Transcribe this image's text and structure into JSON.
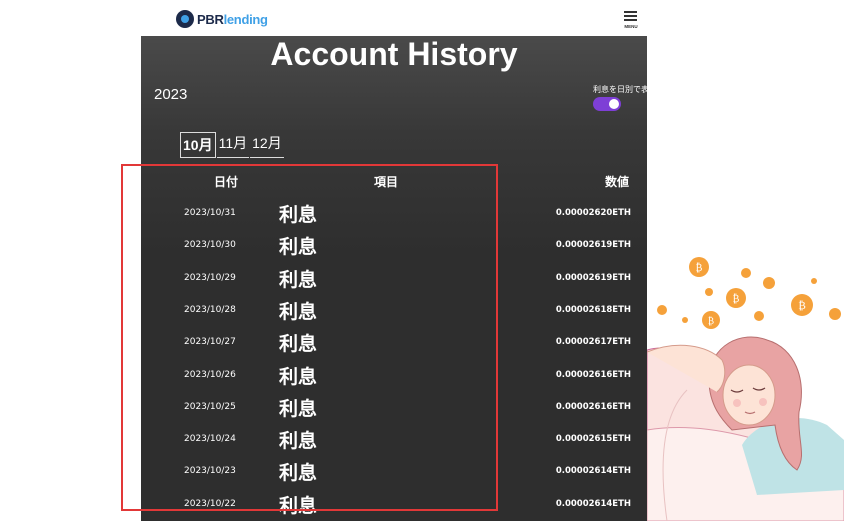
{
  "brand": {
    "logo_pbr": "PBR",
    "logo_lending": "lending"
  },
  "menu": {
    "label": "MENU"
  },
  "page_title": "Account History",
  "year": "2023",
  "toggle": {
    "label": "利息を日別で表示",
    "on": true,
    "color": "#7e3fd6"
  },
  "months": [
    {
      "label": "10月",
      "active": true
    },
    {
      "label": "11月",
      "active": false
    },
    {
      "label": "12月",
      "active": false
    }
  ],
  "table": {
    "headers": {
      "date": "日付",
      "item": "項目",
      "value": "数値"
    },
    "rows": [
      {
        "date": "2023/10/31",
        "item": "利息",
        "amount": "0.00002620ETH"
      },
      {
        "date": "2023/10/30",
        "item": "利息",
        "amount": "0.00002619ETH"
      },
      {
        "date": "2023/10/29",
        "item": "利息",
        "amount": "0.00002619ETH"
      },
      {
        "date": "2023/10/28",
        "item": "利息",
        "amount": "0.00002618ETH"
      },
      {
        "date": "2023/10/27",
        "item": "利息",
        "amount": "0.00002617ETH"
      },
      {
        "date": "2023/10/26",
        "item": "利息",
        "amount": "0.00002616ETH"
      },
      {
        "date": "2023/10/25",
        "item": "利息",
        "amount": "0.00002616ETH"
      },
      {
        "date": "2023/10/24",
        "item": "利息",
        "amount": "0.00002615ETH"
      },
      {
        "date": "2023/10/23",
        "item": "利息",
        "amount": "0.00002614ETH"
      },
      {
        "date": "2023/10/22",
        "item": "利息",
        "amount": "0.00002614ETH"
      }
    ]
  },
  "colors": {
    "highlight": "#e23838",
    "coin": "#f5a13a",
    "background": "#2e2e2e"
  },
  "decoration": {
    "icon": "bitcoin-coin-icon",
    "figure": "relaxing-woman-illustration"
  }
}
